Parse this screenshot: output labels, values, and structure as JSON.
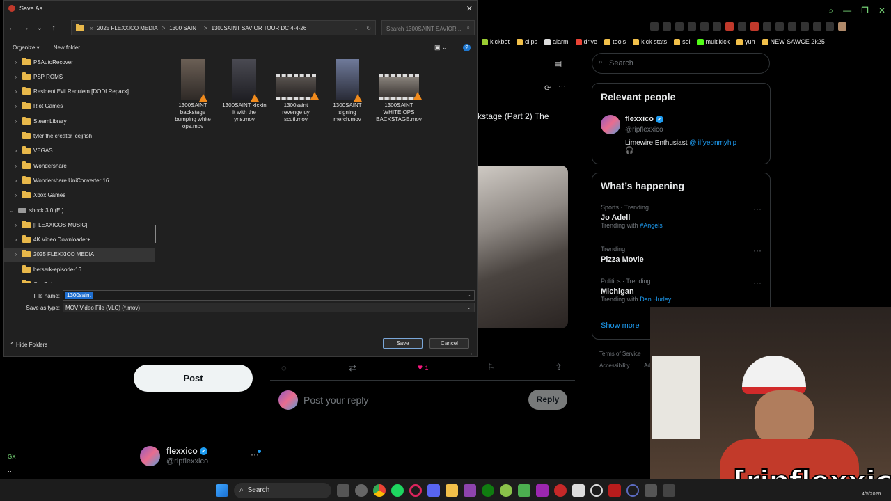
{
  "dialog": {
    "title": "Save As",
    "address": [
      "«",
      "2025 FLEXXICO MEDIA",
      ">",
      "1300 SAINT",
      ">",
      "1300SAINT SAVIOR TOUR DC 4-4-26"
    ],
    "search_placeholder": "Search 1300SAINT SAVIOR ...",
    "organize_label": "Organize ▾",
    "new_folder_label": "New folder",
    "tree": [
      {
        "label": "PSAutoRecover",
        "type": "folder",
        "chev": ">"
      },
      {
        "label": "PSP ROMS",
        "type": "folder",
        "chev": ">"
      },
      {
        "label": "Resident Evil Requiem [DODI Repack]",
        "type": "folder",
        "chev": ">"
      },
      {
        "label": "Riot Games",
        "type": "folder",
        "chev": ">"
      },
      {
        "label": "SteamLibrary",
        "type": "folder",
        "chev": ">"
      },
      {
        "label": "tyler the creator icejjfish",
        "type": "folder",
        "chev": ""
      },
      {
        "label": "VEGAS",
        "type": "folder",
        "chev": ">"
      },
      {
        "label": "Wondershare",
        "type": "folder",
        "chev": ">"
      },
      {
        "label": "Wondershare UniConverter 16",
        "type": "folder",
        "chev": ">"
      },
      {
        "label": "Xbox Games",
        "type": "folder",
        "chev": ">"
      },
      {
        "label": "shock 3.0 (E:)",
        "type": "drive",
        "chev": "v"
      },
      {
        "label": "[FLEXXICOS MUSIC]",
        "type": "folder",
        "chev": ">"
      },
      {
        "label": "4K Video Downloader+",
        "type": "folder",
        "chev": ">"
      },
      {
        "label": "2025 FLEXXICO MEDIA",
        "type": "folder",
        "chev": ">"
      },
      {
        "label": "berserk-episode-16",
        "type": "folder",
        "chev": ""
      },
      {
        "label": "CapCut",
        "type": "folder",
        "chev": ">"
      }
    ],
    "files": [
      {
        "name": "1300SAINT backstage bumping white ops.mov",
        "lines": [
          "1300SAINT",
          "backstage",
          "bumping white",
          "ops.mov"
        ]
      },
      {
        "name": "1300SAINT kickin it with the yns.mov",
        "lines": [
          "1300SAINT kickin",
          "it with the",
          "yns.mov"
        ]
      },
      {
        "name": "1300saint revenge uy scuti.mov",
        "lines": [
          "1300saint",
          "revenge uy",
          "scuti.mov"
        ]
      },
      {
        "name": "1300SAINT signing merch.mov",
        "lines": [
          "1300SAINT",
          "signing",
          "merch.mov"
        ]
      },
      {
        "name": "1300SAINT WHITE OPS BACKSTAGE.mov",
        "lines": [
          "1300SAINT",
          "WHITE OPS",
          "BACKSTAGE.mov"
        ]
      }
    ],
    "file_name_label": "File name:",
    "file_name_value": "1300saint",
    "save_type_label": "Save as type:",
    "save_type_value": "MOV Video File (VLC) (*.mov)",
    "hide_folders_label": "Hide Folders",
    "save_label": "Save",
    "cancel_label": "Cancel"
  },
  "bookmarks": [
    "kickbot",
    "clips",
    "alarm",
    "drive",
    "tools",
    "kick stats",
    "sol",
    "multikick",
    "yuh",
    "NEW SAWCE 2k25"
  ],
  "x": {
    "search_placeholder": "Search",
    "post_fragment": "kstage (Part 2) The",
    "relevant_people_title": "Relevant people",
    "person": {
      "name": "flexxico",
      "handle": "@ripflexxico",
      "bio": "Limewire Enthusiast",
      "bio_link": "@lilfyeonmyhip",
      "bio_tail": "🎧"
    },
    "whats_happening_title": "What’s happening",
    "trends": [
      {
        "meta": "Sports · Trending",
        "title": "Jo Adell",
        "with_label": "Trending with",
        "with_link": "#Angels"
      },
      {
        "meta": "Trending",
        "title": "Pizza Movie",
        "with_label": "",
        "with_link": ""
      },
      {
        "meta": "Politics · Trending",
        "title": "Michigan",
        "with_label": "Trending with",
        "with_link": "Dan Hurley"
      }
    ],
    "show_more": "Show more",
    "footer_links": [
      "Terms of Service",
      "Accessibility",
      "Ad"
    ],
    "like_count": "1",
    "post_button": "Post",
    "reply_placeholder": "Post your reply",
    "reply_button": "Reply",
    "account_name": "flexxico",
    "account_handle": "@ripflexxico",
    "gx_label": "GX"
  },
  "stream_tag": "[ripflexxico]",
  "taskbar": {
    "search_label": "Search",
    "date": "4/5/2026"
  }
}
